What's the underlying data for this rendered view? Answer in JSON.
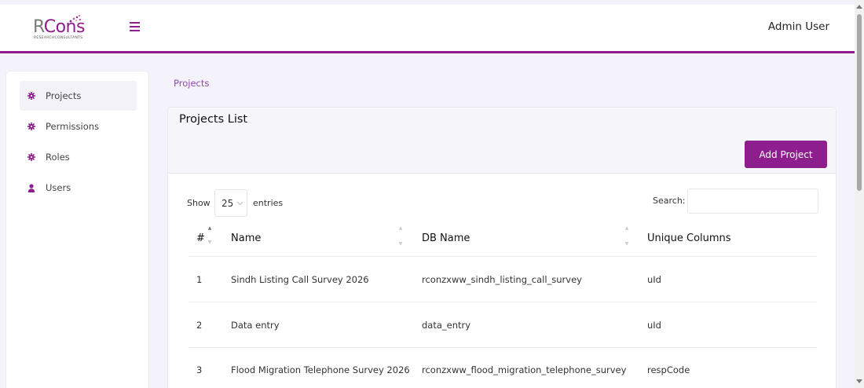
{
  "header": {
    "logo_main_r": "R",
    "logo_main_cons": "Cons",
    "logo_sub": "RESEARCHCONSULTANTS",
    "user_label": "Admin User"
  },
  "sidebar": {
    "items": [
      {
        "label": "Projects",
        "icon": "gear-icon",
        "active": true
      },
      {
        "label": "Permissions",
        "icon": "gear-icon",
        "active": false
      },
      {
        "label": "Roles",
        "icon": "gear-icon",
        "active": false
      },
      {
        "label": "Users",
        "icon": "user-icon",
        "active": false
      }
    ]
  },
  "breadcrumb": {
    "label": "Projects"
  },
  "card": {
    "title": "Projects List",
    "add_button": "Add Project"
  },
  "table_controls": {
    "show_label": "Show",
    "entries_value": "25",
    "entries_label": "entries",
    "search_label": "Search:",
    "search_value": ""
  },
  "table": {
    "columns": [
      "#",
      "Name",
      "DB Name",
      "Unique Columns"
    ],
    "rows": [
      {
        "num": "1",
        "name": "Sindh Listing Call Survey 2026",
        "db": "rconzxww_sindh_listing_call_survey",
        "unique": "uId"
      },
      {
        "num": "2",
        "name": "Data entry",
        "db": "data_entry",
        "unique": "uId"
      },
      {
        "num": "3",
        "name": "Flood Migration Telephone Survey 2026",
        "db": "rconzxww_flood_migration_telephone_survey",
        "unique": "respCode"
      }
    ]
  },
  "colors": {
    "accent": "#8e1e8e",
    "background": "#f4f3fb",
    "breadcrumb": "#8e4aa8"
  }
}
